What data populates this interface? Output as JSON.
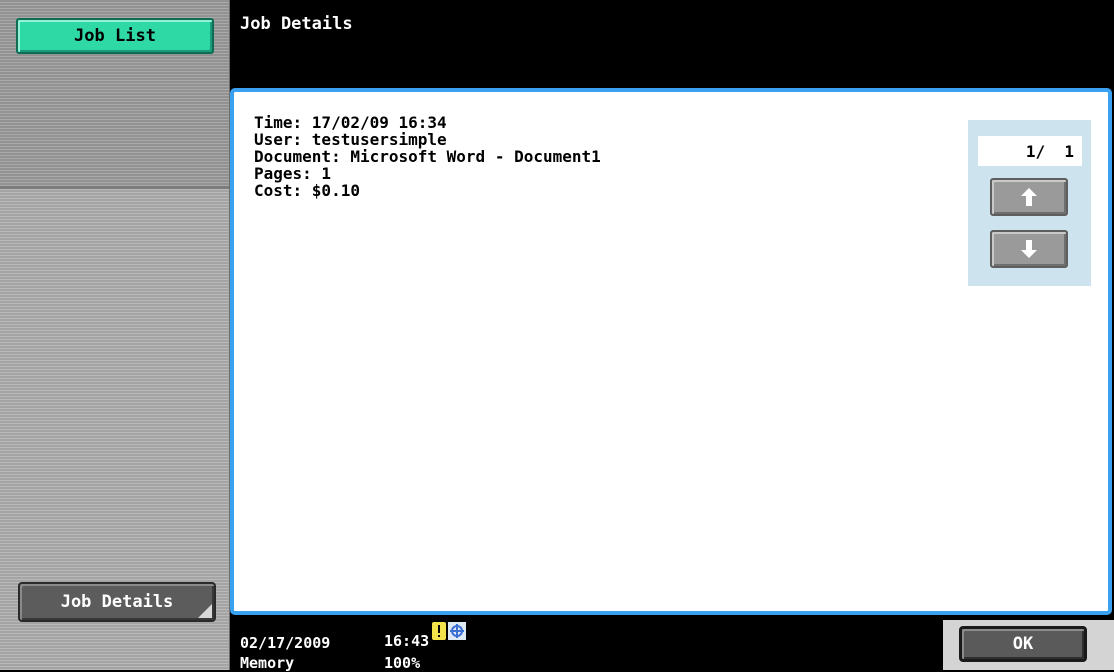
{
  "sidebar": {
    "job_list_label": "Job List",
    "job_details_label": "Job Details"
  },
  "header": {
    "title": "Job Details"
  },
  "details": {
    "time": "Time: 17/02/09 16:34",
    "user": "User: testusersimple",
    "document": "Document: Microsoft Word - Document1",
    "pages": "Pages: 1",
    "cost": "Cost: $0.10"
  },
  "pager": {
    "page_indicator": "1/  1",
    "up_icon": "arrow-up-icon",
    "down_icon": "arrow-down-icon"
  },
  "status": {
    "date": "02/17/2009",
    "time": "16:43",
    "memory_label": "Memory",
    "memory_value": "100%",
    "icons": [
      "warning-icon",
      "network-icon"
    ]
  },
  "ok_label": "OK",
  "colors": {
    "accent_button": "#2fd9a6",
    "panel_border": "#3aa0f0",
    "pager_bg": "#cde4ee"
  }
}
